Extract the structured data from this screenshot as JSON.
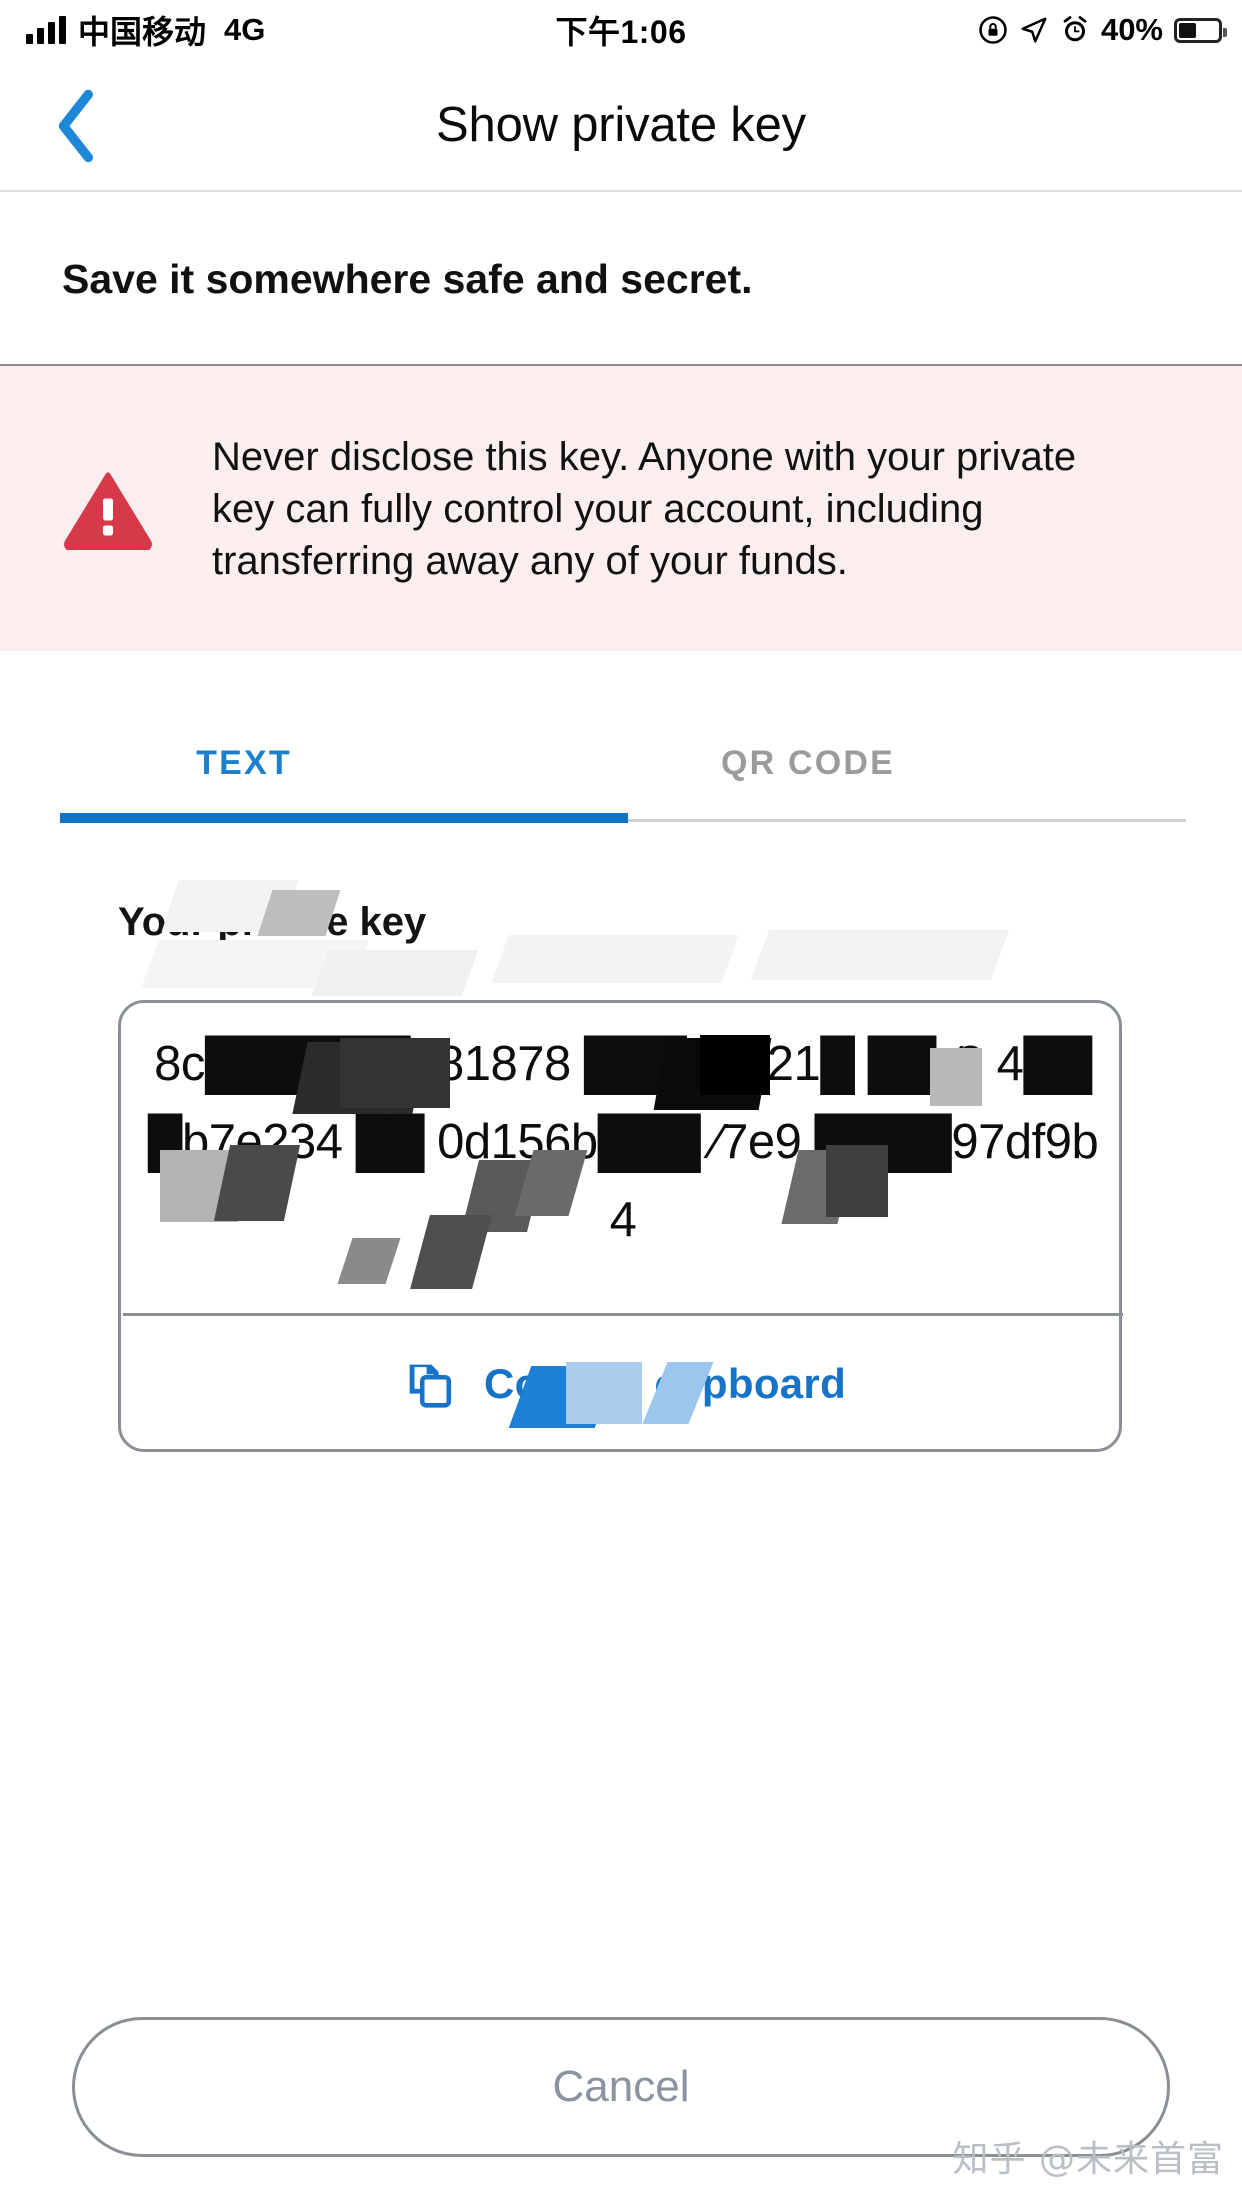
{
  "status_bar": {
    "carrier": "中国移动",
    "network": "4G",
    "time": "下午1:06",
    "battery_percent": "40%",
    "icons": [
      "signal-bars-icon",
      "rotation-lock-icon",
      "location-arrow-icon",
      "alarm-clock-icon",
      "battery-icon"
    ]
  },
  "nav": {
    "back_icon": "chevron-left-icon",
    "title": "Show private key"
  },
  "subtitle": "Save it somewhere safe and secret.",
  "warning": {
    "icon": "warning-triangle-icon",
    "text": "Never disclose this key. Anyone with your private key can fully control your account, including transferring away any of your funds.",
    "background_color": "#fbeeef",
    "icon_color": "#d6394a"
  },
  "tabs": {
    "items": [
      {
        "label": "TEXT",
        "active": true
      },
      {
        "label": "QR CODE",
        "active": false
      }
    ],
    "active_color": "#1173c4",
    "inactive_color": "#9b9b9b"
  },
  "key_section": {
    "label": "Your private key",
    "value": "8c██████b81878 ███80821█ ██ ⁄3 4███b7e234 ██ 0d156b███ ⁄7e9 ████97df9b4",
    "copy_button": {
      "icon": "copy-icon",
      "label": "Copy to clipboard",
      "color": "#1673c8"
    }
  },
  "cancel_button": {
    "label": "Cancel"
  },
  "watermark": "知乎 @未来首富"
}
